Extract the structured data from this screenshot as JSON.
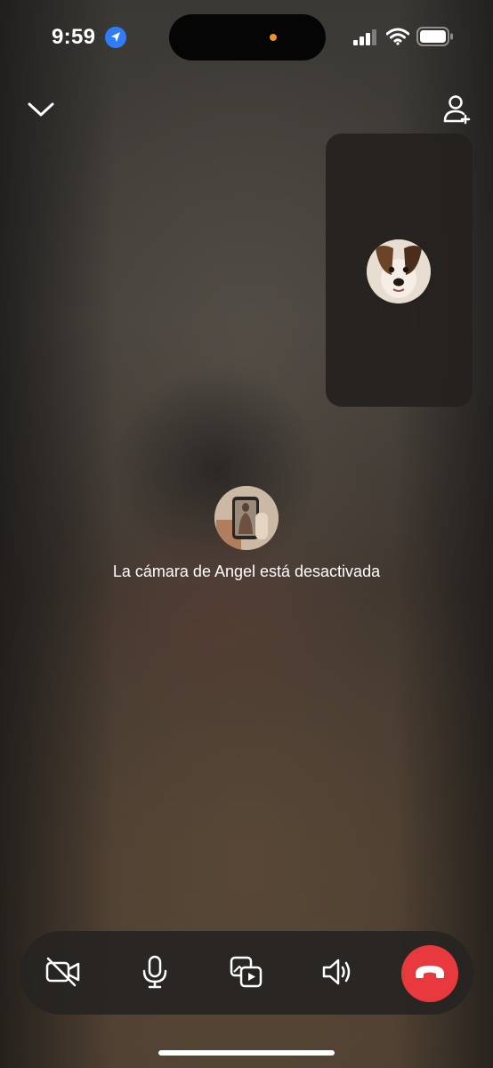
{
  "status_bar": {
    "time": "9:59",
    "location_icon": "location-arrow-icon",
    "signal_icon": "cellular-signal-icon",
    "wifi_icon": "wifi-icon",
    "battery_icon": "battery-icon",
    "accent_color": "#2e7cf6",
    "recording_dot_color": "#f2902a"
  },
  "header": {
    "collapse_icon": "chevron-down-icon",
    "add_people_icon": "add-person-icon"
  },
  "self_view": {
    "avatar_icon": "dog-profile-photo"
  },
  "remote": {
    "avatar_icon": "profile-photo",
    "status_text": "La cámara de Angel está desactivada"
  },
  "controls": {
    "items": [
      {
        "name": "camera-toggle",
        "icon": "video-off-icon"
      },
      {
        "name": "microphone",
        "icon": "microphone-icon"
      },
      {
        "name": "media-share",
        "icon": "media-share-icon"
      },
      {
        "name": "speaker",
        "icon": "speaker-icon"
      },
      {
        "name": "end-call",
        "icon": "end-call-icon",
        "color": "#e8393f"
      }
    ]
  }
}
